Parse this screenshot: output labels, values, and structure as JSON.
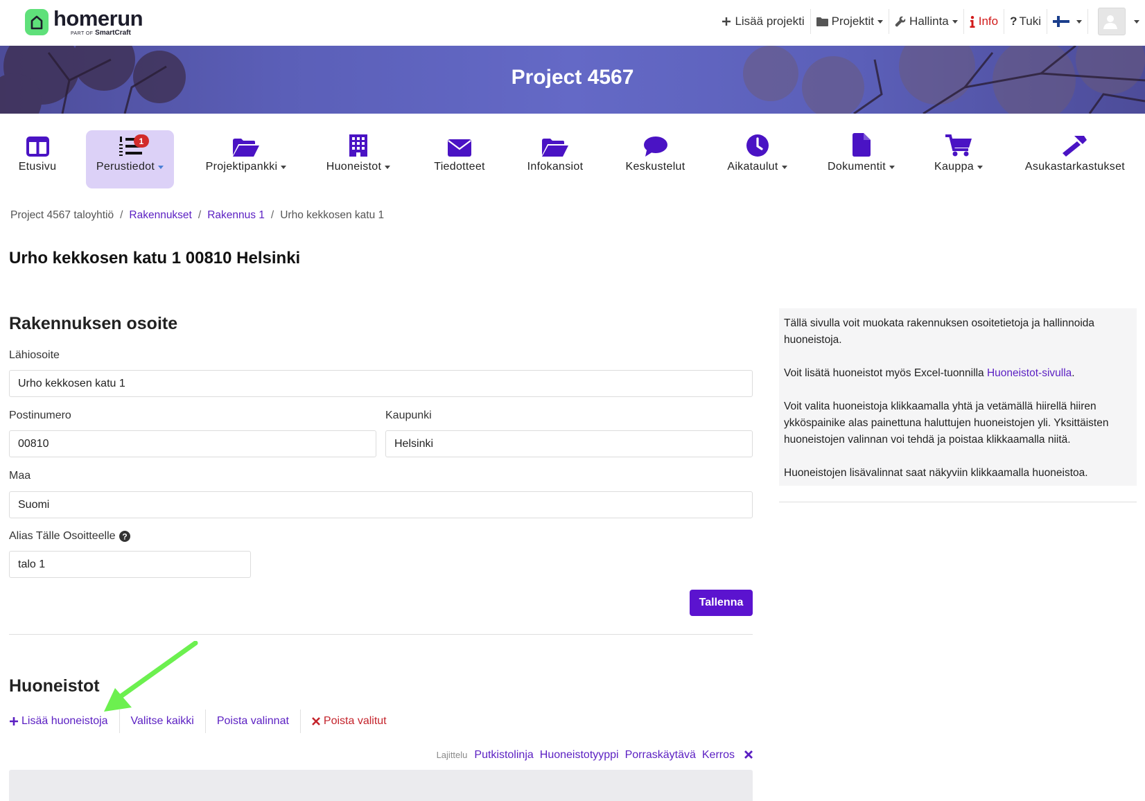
{
  "brand": {
    "name": "homerun",
    "sub_prefix": "PART OF",
    "sub_brand": "SmartCraft"
  },
  "topnav": {
    "add_project": "Lisää projekti",
    "projects": "Projektit",
    "admin": "Hallinta",
    "info": "Info",
    "support": "Tuki",
    "language": "fi-flag-icon"
  },
  "banner": {
    "title": "Project 4567"
  },
  "modules": [
    {
      "label": "Etusivu",
      "icon": "columns-icon"
    },
    {
      "label": "Perustiedot",
      "icon": "numbered-list-icon",
      "badge": "1"
    },
    {
      "label": "Projektipankki",
      "icon": "folder-open-icon"
    },
    {
      "label": "Huoneistot",
      "icon": "building-icon"
    },
    {
      "label": "Tiedotteet",
      "icon": "envelope-icon"
    },
    {
      "label": "Infokansiot",
      "icon": "folder-open-icon"
    },
    {
      "label": "Keskustelut",
      "icon": "comment-icon"
    },
    {
      "label": "Aikataulut",
      "icon": "clock-icon"
    },
    {
      "label": "Dokumentit",
      "icon": "file-icon"
    },
    {
      "label": "Kauppa",
      "icon": "cart-icon"
    },
    {
      "label": "Asukastarkastukset",
      "icon": "hammer-icon"
    }
  ],
  "breadcrumb": {
    "root": "Project 4567 taloyhtiö",
    "sep": "/",
    "buildings": "Rakennukset",
    "building": "Rakennus 1",
    "current": "Urho kekkosen katu 1"
  },
  "page_title": "Urho kekkosen katu 1 00810 Helsinki",
  "address_form": {
    "title": "Rakennuksen osoite",
    "street_label": "Lähiosoite",
    "street_value": "Urho kekkosen katu 1",
    "postal_label": "Postinumero",
    "postal_value": "00810",
    "city_label": "Kaupunki",
    "city_value": "Helsinki",
    "country_label": "Maa",
    "country_value": "Suomi",
    "alias_label": "Alias Tälle Osoitteelle",
    "alias_value": "talo 1",
    "save_label": "Tallenna"
  },
  "info": {
    "p1": "Tällä sivulla voit muokata rakennuksen osoitetietoja ja hallinnoida huoneistoja.",
    "p2_pre": "Voit lisätä huoneistot myös Excel-tuonnilla ",
    "p2_link": "Huoneistot-sivulla",
    "p2_post": ".",
    "p3": "Voit valita huoneistoja klikkaamalla yhtä ja vetämällä hiirellä hiiren ykköspainike alas painettuna haluttujen huoneistojen yli. Yksittäisten huoneistojen valinnan voi tehdä ja poistaa klikkaamalla niitä.",
    "p4": "Huoneistojen lisävalinnat saat näkyviin klikkaamalla huoneistoa."
  },
  "apartments": {
    "title": "Huoneistot",
    "add": "Lisää huoneistoja",
    "select_all": "Valitse kaikki",
    "clear_selection": "Poista valinnat",
    "delete_selected": "Poista valitut",
    "sort_label": "Lajittelu",
    "sort_options": [
      "Putkistolinja",
      "Huoneistotyyppi",
      "Porraskäytävä",
      "Kerros"
    ]
  },
  "colors": {
    "accent": "#5b13cf",
    "link": "#5a1ec2",
    "danger": "#c4232b",
    "active_tab": "#dcd1f7",
    "brand_green": "#5fe07a",
    "annotation_arrow": "#6cf04f"
  }
}
